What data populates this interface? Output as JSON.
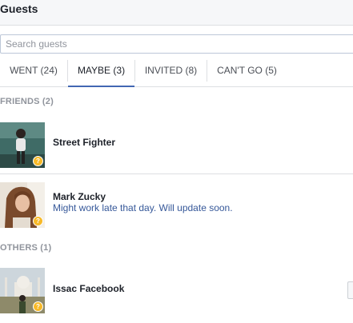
{
  "header": {
    "title": "Guests"
  },
  "search": {
    "placeholder": "Search guests"
  },
  "tabs": [
    {
      "label": "WENT (24)",
      "active": false
    },
    {
      "label": "MAYBE (3)",
      "active": true
    },
    {
      "label": "INVITED (8)",
      "active": false
    },
    {
      "label": "CAN'T GO (5)",
      "active": false
    }
  ],
  "sections": {
    "friends": {
      "heading": "FRIENDS (2)",
      "guests": [
        {
          "name": "Street Fighter",
          "note": "",
          "status_icon": "question-badge-icon"
        },
        {
          "name": "Mark Zucky",
          "note": "Might work late that day. Will update soon.",
          "status_icon": "question-badge-icon"
        }
      ]
    },
    "others": {
      "heading": "OTHERS (1)",
      "guests": [
        {
          "name": "Issac Facebook",
          "note": "",
          "status_icon": "question-badge-icon"
        }
      ]
    }
  },
  "badge_glyph": "?",
  "colors": {
    "accent": "#4267b2",
    "link": "#365899",
    "muted": "#90949c",
    "badge": "#f7b928"
  }
}
